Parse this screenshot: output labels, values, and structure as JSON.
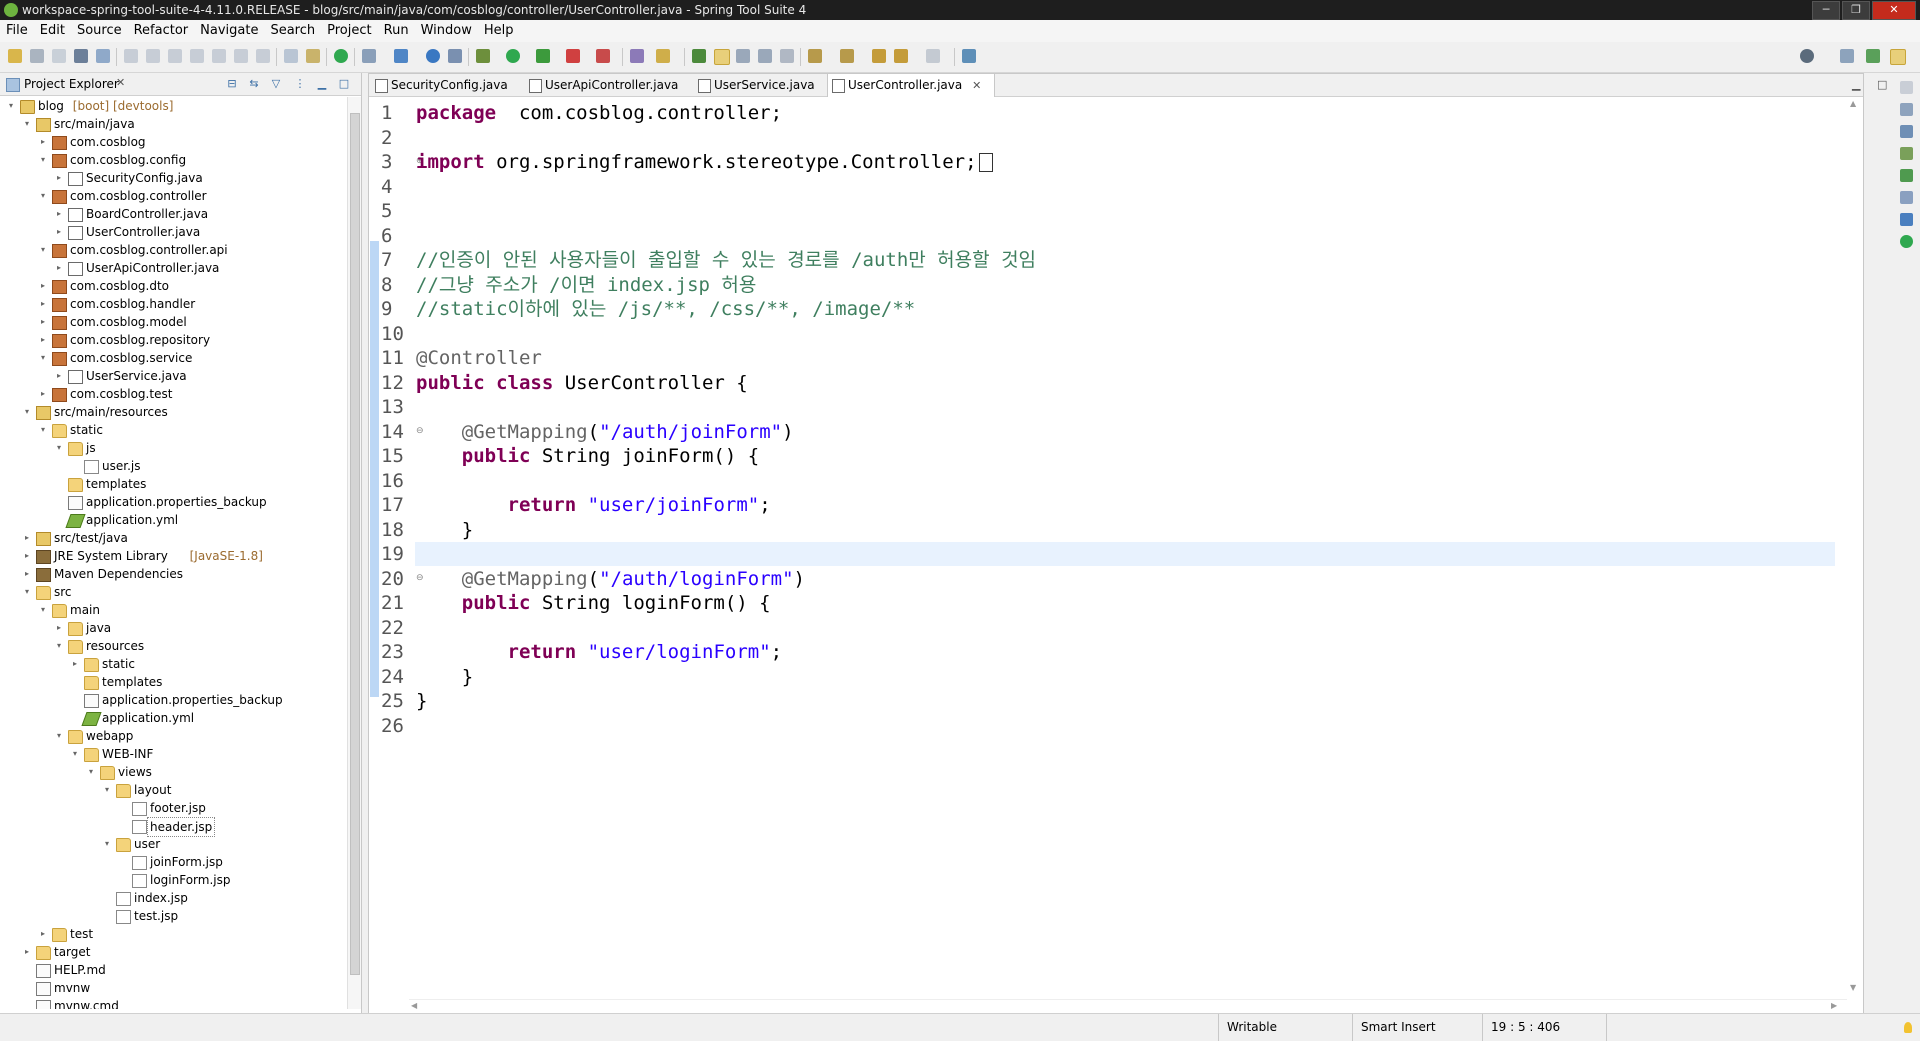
{
  "window": {
    "title": "workspace-spring-tool-suite-4-4.11.0.RELEASE - blog/src/main/java/com/cosblog/controller/UserController.java - Spring Tool Suite 4",
    "minimize": "─",
    "maximize": "❐",
    "close": "✕"
  },
  "menu": [
    "File",
    "Edit",
    "Source",
    "Refactor",
    "Navigate",
    "Search",
    "Project",
    "Run",
    "Window",
    "Help"
  ],
  "explorer": {
    "title": "Project Explorer",
    "close": "✕",
    "tree": [
      {
        "label": "blog",
        "extra": "[boot] [devtools]",
        "icon": "project",
        "arrow": "▾"
      },
      {
        "label": "src/main/java",
        "icon": "srcfolder",
        "arrow": "▾"
      },
      {
        "label": "com.cosblog",
        "icon": "package",
        "arrow": "▸"
      },
      {
        "label": "com.cosblog.config",
        "icon": "package",
        "arrow": "▾"
      },
      {
        "label": "SecurityConfig.java",
        "icon": "java",
        "arrow": "▸"
      },
      {
        "label": "com.cosblog.controller",
        "icon": "package",
        "arrow": "▾"
      },
      {
        "label": "BoardController.java",
        "icon": "java",
        "arrow": "▸"
      },
      {
        "label": "UserController.java",
        "icon": "java",
        "arrow": "▸"
      },
      {
        "label": "com.cosblog.controller.api",
        "icon": "package",
        "arrow": "▾"
      },
      {
        "label": "UserApiController.java",
        "icon": "java",
        "arrow": "▸"
      },
      {
        "label": "com.cosblog.dto",
        "icon": "package",
        "arrow": "▸"
      },
      {
        "label": "com.cosblog.handler",
        "icon": "package",
        "arrow": "▸"
      },
      {
        "label": "com.cosblog.model",
        "icon": "package",
        "arrow": "▸"
      },
      {
        "label": "com.cosblog.repository",
        "icon": "package",
        "arrow": "▸"
      },
      {
        "label": "com.cosblog.service",
        "icon": "package",
        "arrow": "▾"
      },
      {
        "label": "UserService.java",
        "icon": "java",
        "arrow": "▸"
      },
      {
        "label": "com.cosblog.test",
        "icon": "package",
        "arrow": "▸"
      },
      {
        "label": "src/main/resources",
        "icon": "srcfolder",
        "arrow": "▾"
      },
      {
        "label": "static",
        "icon": "folder",
        "arrow": "▾"
      },
      {
        "label": "js",
        "icon": "folder",
        "arrow": "▾"
      },
      {
        "label": "user.js",
        "icon": "js",
        "arrow": ""
      },
      {
        "label": "templates",
        "icon": "folder",
        "arrow": ""
      },
      {
        "label": "application.properties_backup",
        "icon": "file",
        "arrow": ""
      },
      {
        "label": "application.yml",
        "icon": "yml",
        "arrow": ""
      },
      {
        "label": "src/test/java",
        "icon": "srcfolder",
        "arrow": "▸"
      },
      {
        "label": "JRE System Library",
        "extra": "[JavaSE-1.8]",
        "icon": "jar",
        "arrow": "▸"
      },
      {
        "label": "Maven Dependencies",
        "icon": "jar",
        "arrow": "▸"
      },
      {
        "label": "src",
        "icon": "folder",
        "arrow": "▾"
      },
      {
        "label": "main",
        "icon": "folder",
        "arrow": "▾"
      },
      {
        "label": "java",
        "icon": "folder",
        "arrow": "▸"
      },
      {
        "label": "resources",
        "icon": "folder",
        "arrow": "▾"
      },
      {
        "label": "static",
        "icon": "folder",
        "arrow": "▸"
      },
      {
        "label": "templates",
        "icon": "folder",
        "arrow": ""
      },
      {
        "label": "application.properties_backup",
        "icon": "file",
        "arrow": ""
      },
      {
        "label": "application.yml",
        "icon": "yml",
        "arrow": ""
      },
      {
        "label": "webapp",
        "icon": "folder",
        "arrow": "▾"
      },
      {
        "label": "WEB-INF",
        "icon": "folder",
        "arrow": "▾"
      },
      {
        "label": "views",
        "icon": "folder",
        "arrow": "▾"
      },
      {
        "label": "layout",
        "icon": "folder",
        "arrow": "▾"
      },
      {
        "label": "footer.jsp",
        "icon": "jsp",
        "arrow": ""
      },
      {
        "label": "header.jsp",
        "icon": "jsp",
        "arrow": "",
        "selected": true
      },
      {
        "label": "user",
        "icon": "folder",
        "arrow": "▾"
      },
      {
        "label": "joinForm.jsp",
        "icon": "jsp",
        "arrow": ""
      },
      {
        "label": "loginForm.jsp",
        "icon": "jsp",
        "arrow": ""
      },
      {
        "label": "index.jsp",
        "icon": "jsp",
        "arrow": ""
      },
      {
        "label": "test.jsp",
        "icon": "jsp",
        "arrow": ""
      },
      {
        "label": "test",
        "icon": "folder",
        "arrow": "▸"
      },
      {
        "label": "target",
        "icon": "folder",
        "arrow": "▸"
      },
      {
        "label": "HELP.md",
        "icon": "file",
        "arrow": ""
      },
      {
        "label": "mvnw",
        "icon": "file",
        "arrow": ""
      },
      {
        "label": "mvnw.cmd",
        "icon": "file",
        "arrow": ""
      }
    ]
  },
  "tabs": [
    {
      "label": "SecurityConfig.java",
      "active": false
    },
    {
      "label": "UserApiController.java",
      "active": false
    },
    {
      "label": "UserService.java",
      "active": false
    },
    {
      "label": "UserController.java",
      "active": true,
      "close": "✕"
    }
  ],
  "editor": {
    "current_line": 19,
    "lines": [
      {
        "n": "1",
        "parts": [
          [
            "kw",
            "package"
          ],
          [
            "",
            "  com.cosblog.controller;"
          ]
        ]
      },
      {
        "n": "2",
        "parts": []
      },
      {
        "n": "3",
        "fold": "⊕",
        "parts": [
          [
            "kw",
            "import"
          ],
          [
            "",
            " org.springframework.stereotype.Controller;"
          ]
        ],
        "box": true
      },
      {
        "n": "4",
        "parts": []
      },
      {
        "n": "5",
        "parts": []
      },
      {
        "n": "6",
        "parts": []
      },
      {
        "n": "7",
        "parts": [
          [
            "cm",
            "//인증이 안된 사용자들이 출입할 수 있는 경로를 /auth만 허용할 것임"
          ]
        ]
      },
      {
        "n": "8",
        "parts": [
          [
            "cm",
            "//그냥 주소가 /이면 index.jsp 허용"
          ]
        ]
      },
      {
        "n": "9",
        "parts": [
          [
            "cm",
            "//static이하에 있는 /js/**, /css/**, /image/**"
          ]
        ]
      },
      {
        "n": "10",
        "parts": []
      },
      {
        "n": "11",
        "parts": [
          [
            "an",
            "@Controller"
          ]
        ]
      },
      {
        "n": "12",
        "parts": [
          [
            "kw",
            "public class"
          ],
          [
            "",
            " UserController {"
          ]
        ]
      },
      {
        "n": "13",
        "parts": []
      },
      {
        "n": "14",
        "fold": "⊖",
        "parts": [
          [
            "",
            "    "
          ],
          [
            "an",
            "@GetMapping"
          ],
          [
            "",
            "("
          ],
          [
            "st",
            "\"/auth/joinForm\""
          ],
          [
            "",
            ")"
          ]
        ]
      },
      {
        "n": "15",
        "parts": [
          [
            "",
            "    "
          ],
          [
            "kw",
            "public"
          ],
          [
            "",
            " String joinForm() {"
          ]
        ]
      },
      {
        "n": "16",
        "parts": []
      },
      {
        "n": "17",
        "parts": [
          [
            "",
            "        "
          ],
          [
            "kw",
            "return"
          ],
          [
            "",
            " "
          ],
          [
            "st",
            "\"user/joinForm\""
          ],
          [
            "",
            ";"
          ]
        ]
      },
      {
        "n": "18",
        "parts": [
          [
            "",
            "    }"
          ]
        ]
      },
      {
        "n": "19",
        "parts": []
      },
      {
        "n": "20",
        "fold": "⊖",
        "parts": [
          [
            "",
            "    "
          ],
          [
            "an",
            "@GetMapping"
          ],
          [
            "",
            "("
          ],
          [
            "st",
            "\"/auth/loginForm\""
          ],
          [
            "",
            ")"
          ]
        ]
      },
      {
        "n": "21",
        "parts": [
          [
            "",
            "    "
          ],
          [
            "kw",
            "public"
          ],
          [
            "",
            " String loginForm() {"
          ]
        ]
      },
      {
        "n": "22",
        "parts": []
      },
      {
        "n": "23",
        "parts": [
          [
            "",
            "        "
          ],
          [
            "kw",
            "return"
          ],
          [
            "",
            " "
          ],
          [
            "st",
            "\"user/loginForm\""
          ],
          [
            "",
            ";"
          ]
        ]
      },
      {
        "n": "24",
        "parts": [
          [
            "",
            "    }"
          ]
        ]
      },
      {
        "n": "25",
        "parts": [
          [
            "",
            "}"
          ]
        ]
      },
      {
        "n": "26",
        "parts": []
      }
    ]
  },
  "status": {
    "writable": "Writable",
    "insert_mode": "Smart Insert",
    "position": "19 : 5 : 406"
  },
  "colors": {
    "keyword": "#7f0055",
    "comment": "#3f7f5f",
    "string": "#2a00ff",
    "annotation": "#646464",
    "current_line": "#e8f2fe"
  }
}
